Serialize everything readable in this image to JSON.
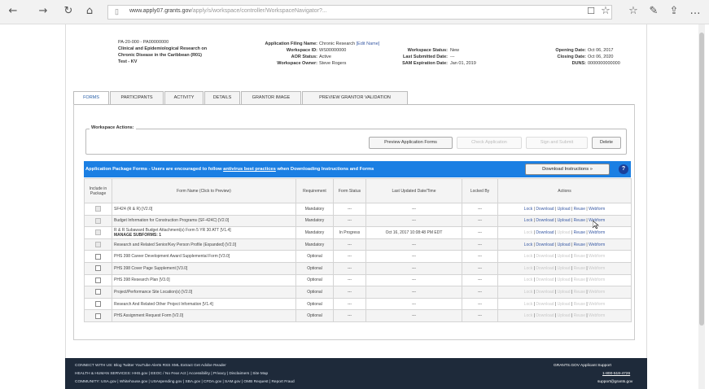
{
  "browser": {
    "back_icon": "←",
    "forward_icon": "→",
    "reload_icon": "↻",
    "home_icon": "⌂",
    "lock_icon": "🔒",
    "url_domain": "www.apply07.grants.gov",
    "url_path": "/apply/s/workspace/controller/WorkspaceNavigator?...",
    "icons": [
      "☐",
      "☆",
      "☆",
      "✎",
      "⇪",
      "…"
    ]
  },
  "header": {
    "opportunity_number": "PA-20-000 - PA00000000",
    "opportunity_title_line1": "Clinical and Epidemiological Research on",
    "opportunity_title_line2": "Chronic Disease in the Caribbean (R01)",
    "opportunity_title_line3": "Test - KV",
    "application_filing_name_label": "Application Filing Name:",
    "application_filing_name": "Chronic Research",
    "edit_name_link": "[Edit Name]",
    "workspace_id_label": "Workspace ID:",
    "workspace_id": "WS00000000",
    "aor_status_label": "AOR Status:",
    "aor_status": "Active",
    "workspace_owner_label": "Workspace Owner:",
    "workspace_owner": "Steve Rogers",
    "workspace_status_label": "Workspace Status:",
    "workspace_status": "New",
    "last_submitted_label": "Last Submitted Date:",
    "last_submitted": "---",
    "sam_expiration_label": "SAM Expiration Date:",
    "sam_expiration": "Jan 01, 2019",
    "opening_date_label": "Opening Date:",
    "opening_date": "Oct 06, 2017",
    "closing_date_label": "Closing Date:",
    "closing_date": "Oct 06, 2020",
    "duns_label": "DUNS:",
    "duns": "0000000000000"
  },
  "tabs": [
    "FORMS",
    "PARTICIPANTS",
    "ACTIVITY",
    "DETAILS",
    "GRANTOR IMAGE",
    "PREVIEW GRANTOR VALIDATION"
  ],
  "workspace_actions": {
    "legend": "Workspace Actions:",
    "preview_forms": "Preview Application Forms",
    "check_application": "Check Application",
    "sign_submit": "Sign and Submit",
    "delete": "Delete"
  },
  "package": {
    "banner_prefix": "Application Package Forms - Users are encouraged to follow ",
    "banner_link": "antivirus best practices",
    "banner_suffix": " when Downloading Instructions and Forms",
    "download_instructions": "Download Instructions »",
    "help_icon": "?"
  },
  "table": {
    "headers": [
      "Include in Package",
      "Form Name (Click to Preview)",
      "Requirement",
      "Form Status",
      "Last Updated Date/Time",
      "Locked By",
      "Actions"
    ],
    "rows": [
      {
        "name": "SF424 (R & R) [V2.0]",
        "req": "Mandatory",
        "status": "---",
        "updated": "---",
        "locked": "---"
      },
      {
        "name": "Budget Information for Construction Programs (SF-424C) [V2.0]",
        "req": "Mandatory",
        "status": "---",
        "updated": "---",
        "locked": "---"
      },
      {
        "name": "R & R Subaward Budget Attachment(s) Form 5 YR 30 ATT [V1.4]",
        "name2": "MANAGE SUBFORMS: 1",
        "req": "Mandatory",
        "status": "In Progress",
        "updated": "Oct 16, 2017 10:08:48 PM EDT",
        "locked": "---"
      },
      {
        "name": "Research and Related Senior/Key Person Profile (Expanded) [V2.0]",
        "req": "Mandatory",
        "status": "---",
        "updated": "---",
        "locked": "---"
      },
      {
        "name": "PHS 398 Career Development Award Supplemental Form [V3.0]",
        "req": "Optional",
        "status": "---",
        "updated": "---",
        "locked": "---"
      },
      {
        "name": "PHS 398 Cover Page Supplement [V3.0]",
        "req": "Optional",
        "status": "---",
        "updated": "---",
        "locked": "---"
      },
      {
        "name": "PHS 398 Research Plan [V3.0]",
        "req": "Optional",
        "status": "---",
        "updated": "---",
        "locked": "---"
      },
      {
        "name": "Project/Performance Site Location(s) [V2.0]",
        "req": "Optional",
        "status": "---",
        "updated": "---",
        "locked": "---"
      },
      {
        "name": "Research And Related Other Project Information [V1.4]",
        "req": "Optional",
        "status": "---",
        "updated": "---",
        "locked": "---"
      },
      {
        "name": "PHS Assignment Request Form [V2.0]",
        "req": "Optional",
        "status": "---",
        "updated": "---",
        "locked": "---"
      }
    ],
    "actions": [
      "Lock",
      "Download",
      "Upload",
      "Reuse",
      "Webform"
    ]
  },
  "footer": {
    "line1": "CONNECT WITH US:   Blog   Twitter   YouTube   Alerts   RSS   XML Extract   Get Adobe Reader",
    "line2": "HEALTH & HUMAN SERVICES: HHS.gov  |  EEOC / No Fear Act  |  Accessibility  |  Privacy  |  Disclaimers  |  Site Map",
    "line3": "COMMUNITY: USA.gov  |  Whitehouse.gov  |  USAspending.gov  |  SBA.gov  |  CFDA.gov  |  SAM.gov  |  OMB Request  |  Report Fraud",
    "support_title": "GRANTS.GOV Applicant Support",
    "support_phone": "1-800-518-4726",
    "support_email": "support@grants.gov"
  },
  "colors": {
    "banner": "#1b7fe3",
    "footer": "#1e2a3a",
    "link": "#3a5ba5",
    "in_progress": "#e07020"
  }
}
